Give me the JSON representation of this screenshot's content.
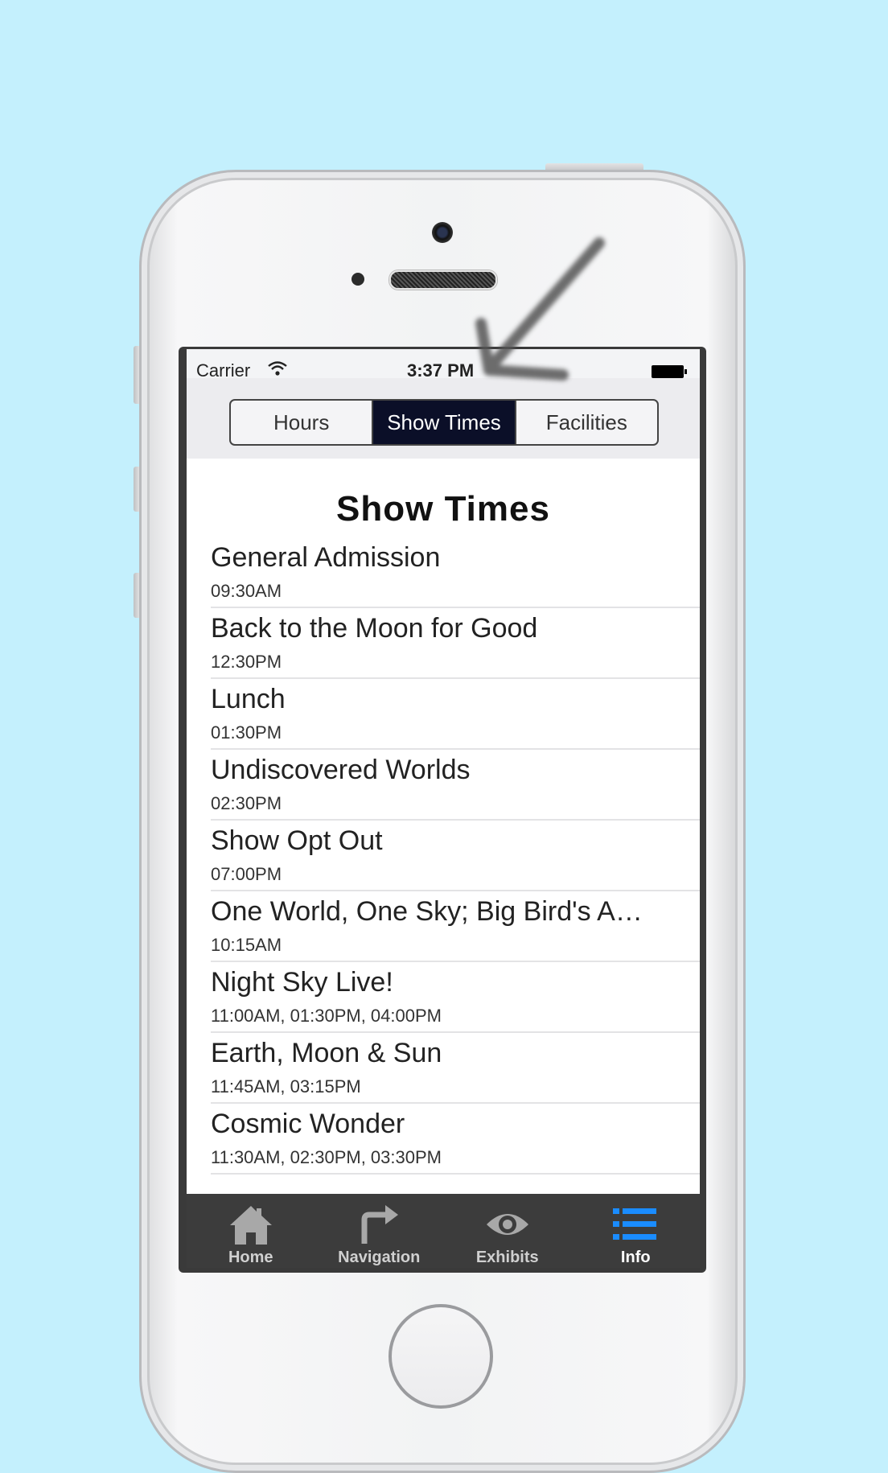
{
  "status_bar": {
    "carrier": "Carrier",
    "time": "3:37 PM"
  },
  "segments": [
    "Hours",
    "Show Times",
    "Facilities"
  ],
  "active_segment": "Show Times",
  "page_title": "Show Times",
  "shows": [
    {
      "name": "General Admission",
      "times": "09:30AM"
    },
    {
      "name": "Back to the Moon for Good",
      "times": "12:30PM"
    },
    {
      "name": "Lunch",
      "times": "01:30PM"
    },
    {
      "name": "Undiscovered Worlds",
      "times": "02:30PM"
    },
    {
      "name": "Show Opt Out",
      "times": "07:00PM"
    },
    {
      "name": "One World, One Sky; Big Bird's A…",
      "times": "10:15AM"
    },
    {
      "name": "Night Sky Live!",
      "times": "11:00AM, 01:30PM, 04:00PM"
    },
    {
      "name": "Earth, Moon & Sun",
      "times": "11:45AM, 03:15PM"
    },
    {
      "name": "Cosmic Wonder",
      "times": "11:30AM, 02:30PM, 03:30PM"
    }
  ],
  "tab_bar": [
    {
      "label": "Home",
      "icon": "home-icon"
    },
    {
      "label": "Navigation",
      "icon": "turn-arrow-icon"
    },
    {
      "label": "Exhibits",
      "icon": "eye-icon"
    },
    {
      "label": "Info",
      "icon": "list-icon"
    }
  ],
  "active_tab": "Info",
  "colors": {
    "background": "#c4f0fd",
    "segment_active": "#0b0f28",
    "tab_active": "#1a8cff",
    "tab_inactive": "#a8a8a8"
  }
}
